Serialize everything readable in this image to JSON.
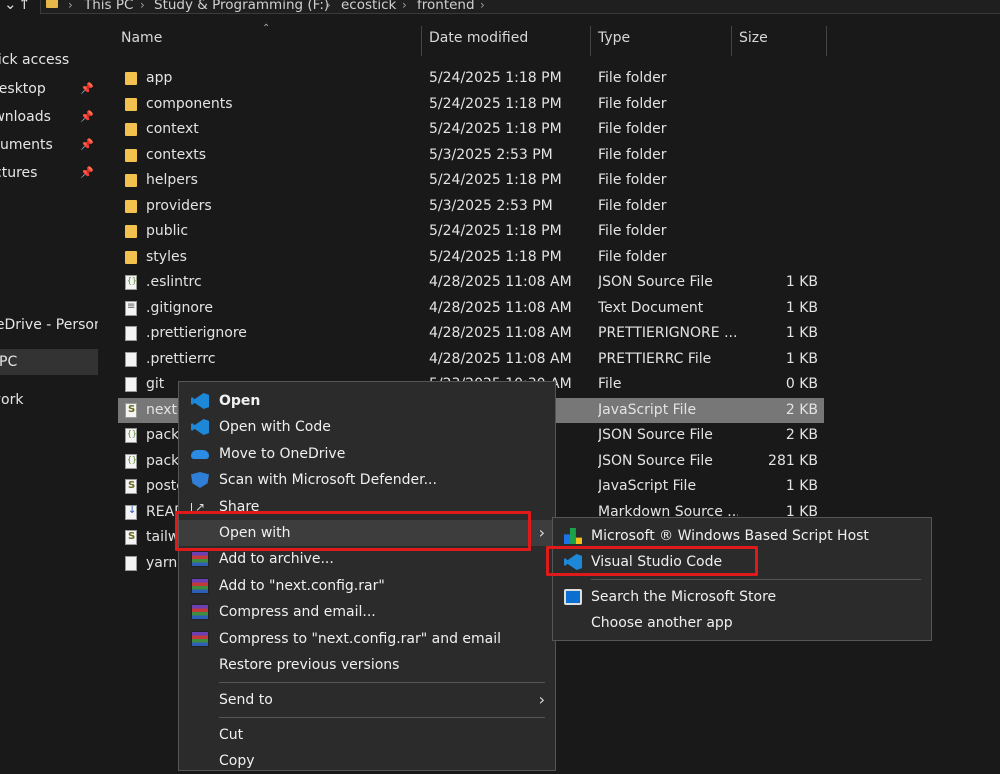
{
  "address": {
    "back_arrow": "↑",
    "crumbs": [
      "This PC",
      "Study & Programming (F:)",
      "ecostick",
      "frontend"
    ]
  },
  "nav": {
    "items": [
      {
        "label": "Quick access",
        "pinned": false
      },
      {
        "label": "Desktop",
        "pinned": true
      },
      {
        "label": "Downloads",
        "pinned": true
      },
      {
        "label": "Documents",
        "pinned": true
      },
      {
        "label": "Pictures",
        "pinned": true
      },
      {
        "label": "OneDrive - Personal",
        "pinned": false
      },
      {
        "label": "This PC",
        "pinned": false
      },
      {
        "label": "Network",
        "pinned": false
      }
    ]
  },
  "columns": {
    "name": "Name",
    "date": "Date modified",
    "type": "Type",
    "size": "Size"
  },
  "files": [
    {
      "name": "app",
      "date": "5/24/2025 1:18 PM",
      "type": "File folder",
      "size": "",
      "icon": "folder"
    },
    {
      "name": "components",
      "date": "5/24/2025 1:18 PM",
      "type": "File folder",
      "size": "",
      "icon": "folder"
    },
    {
      "name": "context",
      "date": "5/24/2025 1:18 PM",
      "type": "File folder",
      "size": "",
      "icon": "folder"
    },
    {
      "name": "contexts",
      "date": "5/3/2025 2:53 PM",
      "type": "File folder",
      "size": "",
      "icon": "folder"
    },
    {
      "name": "helpers",
      "date": "5/24/2025 1:18 PM",
      "type": "File folder",
      "size": "",
      "icon": "folder"
    },
    {
      "name": "providers",
      "date": "5/3/2025 2:53 PM",
      "type": "File folder",
      "size": "",
      "icon": "folder"
    },
    {
      "name": "public",
      "date": "5/24/2025 1:18 PM",
      "type": "File folder",
      "size": "",
      "icon": "folder"
    },
    {
      "name": "styles",
      "date": "5/24/2025 1:18 PM",
      "type": "File folder",
      "size": "",
      "icon": "folder"
    },
    {
      "name": ".eslintrc",
      "date": "4/28/2025 11:08 AM",
      "type": "JSON Source File",
      "size": "1 KB",
      "icon": "json"
    },
    {
      "name": ".gitignore",
      "date": "4/28/2025 11:08 AM",
      "type": "Text Document",
      "size": "1 KB",
      "icon": "txt"
    },
    {
      "name": ".prettierignore",
      "date": "4/28/2025 11:08 AM",
      "type": "PRETTIERIGNORE ...",
      "size": "1 KB",
      "icon": "doc"
    },
    {
      "name": ".prettierrc",
      "date": "4/28/2025 11:08 AM",
      "type": "PRETTIERRC File",
      "size": "1 KB",
      "icon": "doc"
    },
    {
      "name": "git",
      "date": "5/23/2025 10:30 AM",
      "type": "File",
      "size": "0 KB",
      "icon": "doc"
    },
    {
      "name": "next.config.js",
      "date": "",
      "type": "JavaScript File",
      "size": "2 KB",
      "icon": "js"
    },
    {
      "name": "package.json",
      "date": "",
      "type": "JSON Source File",
      "size": "2 KB",
      "icon": "json"
    },
    {
      "name": "package-lock.json",
      "date": "",
      "type": "JSON Source File",
      "size": "281 KB",
      "icon": "json"
    },
    {
      "name": "postcss.config.js",
      "date": "",
      "type": "JavaScript File",
      "size": "1 KB",
      "icon": "js"
    },
    {
      "name": "README.md",
      "date": "",
      "type": "Markdown Source ...",
      "size": "1 KB",
      "icon": "md"
    },
    {
      "name": "tailwind.config.js",
      "date": "",
      "type": "",
      "size": "1 KB",
      "icon": "js"
    },
    {
      "name": "yarn.lock",
      "date": "",
      "type": "",
      "size": "",
      "icon": "doc"
    }
  ],
  "context_menu": {
    "open": "Open",
    "open_with_code": "Open with Code",
    "move_onedrive": "Move to OneDrive",
    "scan_defender": "Scan with Microsoft Defender...",
    "share": "Share",
    "open_with": "Open with",
    "add_archive": "Add to archive...",
    "add_rar": "Add to \"next.config.rar\"",
    "compress_email": "Compress and email...",
    "compress_rar_email": "Compress to \"next.config.rar\" and email",
    "restore": "Restore previous versions",
    "send_to": "Send to",
    "cut": "Cut",
    "copy": "Copy"
  },
  "submenu": {
    "script_host": "Microsoft ® Windows Based Script Host",
    "vscode": "Visual Studio Code",
    "search_store": "Search the Microsoft Store",
    "choose_app": "Choose another app"
  },
  "colors": {
    "highlight": "#e0191b",
    "folder": "#f2c14e",
    "vscode": "#1e88d8"
  }
}
